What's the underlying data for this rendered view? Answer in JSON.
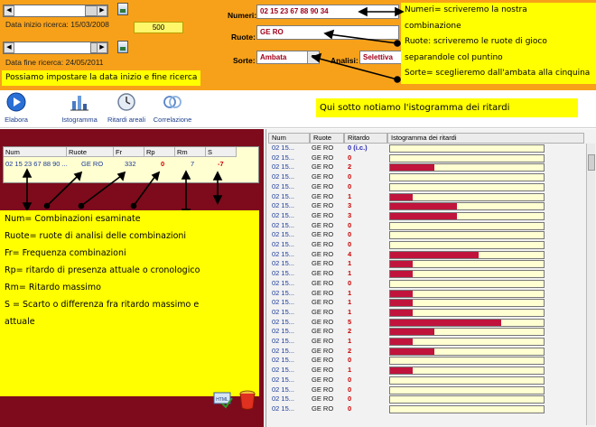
{
  "header": {
    "data_inizio_label": "Data inizio ricerca: 15/03/2008",
    "data_fine_label": "Data fine ricerca: 24/05/2011",
    "counter_value": "500",
    "numeri_label": "Numeri:",
    "numeri_value": "02 15 23 67 88 90 34",
    "ruote_label": "Ruote:",
    "ruote_value": "GE RO",
    "sorte_label": "Sorte:",
    "sorte_value": "Ambata",
    "analisi_label": "Analisi:",
    "analisi_value": "Selettiva"
  },
  "callouts": {
    "date_note": "Possiamo impostare la data inizio e fine ricerca",
    "right_note": [
      "Numeri= scriveremo la nostra",
      "combinazione",
      "Ruote: scriveremo le ruote di gioco",
      "separandole col puntino",
      "Sorte= sceglieremo dall'ambata alla cinquina"
    ],
    "hist_note": "Qui sotto notiamo l'istogramma dei ritardi"
  },
  "toolbar": {
    "elabora": "Elabora",
    "istogramma": "Istogramma",
    "ritardi_areali": "Ritardi areali",
    "correlazione": "Correlazione"
  },
  "left_table": {
    "headers": [
      "Num",
      "Ruote",
      "Fr",
      "Rp",
      "Rm",
      "S"
    ],
    "row": [
      "02 15 23 67 88 90 ...",
      "GE RO",
      "332",
      "0",
      "7",
      "-7"
    ]
  },
  "legend_lines": [
    "Num= Combinazioni esaminate",
    "Ruote= ruote di analisi delle combinazioni",
    "Fr= Frequenza combinazioni",
    "Rp= ritardo di presenza attuale o cronologico",
    "Rm= Ritardo massimo",
    "S = Scarto o differenza fra ritardo massimo e",
    "attuale"
  ],
  "right_table": {
    "headers": [
      "Num",
      "Ruote",
      "Ritardo",
      "Istogramma dei ritardi"
    ],
    "rows": [
      {
        "num": "02 15...",
        "ruote": "GE RO",
        "ritardo": "0 (i.c.)",
        "bar": 0
      },
      {
        "num": "02 15...",
        "ruote": "GE RO",
        "ritardo": "0",
        "bar": 0
      },
      {
        "num": "02 15...",
        "ruote": "GE RO",
        "ritardo": "2",
        "bar": 2
      },
      {
        "num": "02 15...",
        "ruote": "GE RO",
        "ritardo": "0",
        "bar": 0
      },
      {
        "num": "02 15...",
        "ruote": "GE RO",
        "ritardo": "0",
        "bar": 0
      },
      {
        "num": "02 15...",
        "ruote": "GE RO",
        "ritardo": "1",
        "bar": 1
      },
      {
        "num": "02 15...",
        "ruote": "GE RO",
        "ritardo": "3",
        "bar": 3
      },
      {
        "num": "02 15...",
        "ruote": "GE RO",
        "ritardo": "3",
        "bar": 3
      },
      {
        "num": "02 15...",
        "ruote": "GE RO",
        "ritardo": "0",
        "bar": 0
      },
      {
        "num": "02 15...",
        "ruote": "GE RO",
        "ritardo": "0",
        "bar": 0
      },
      {
        "num": "02 15...",
        "ruote": "GE RO",
        "ritardo": "0",
        "bar": 0
      },
      {
        "num": "02 15...",
        "ruote": "GE RO",
        "ritardo": "4",
        "bar": 4
      },
      {
        "num": "02 15...",
        "ruote": "GE RO",
        "ritardo": "1",
        "bar": 1
      },
      {
        "num": "02 15...",
        "ruote": "GE RO",
        "ritardo": "1",
        "bar": 1
      },
      {
        "num": "02 15...",
        "ruote": "GE RO",
        "ritardo": "0",
        "bar": 0
      },
      {
        "num": "02 15...",
        "ruote": "GE RO",
        "ritardo": "1",
        "bar": 1
      },
      {
        "num": "02 15...",
        "ruote": "GE RO",
        "ritardo": "1",
        "bar": 1
      },
      {
        "num": "02 15...",
        "ruote": "GE RO",
        "ritardo": "1",
        "bar": 1
      },
      {
        "num": "02 15...",
        "ruote": "GE RO",
        "ritardo": "5",
        "bar": 5
      },
      {
        "num": "02 15...",
        "ruote": "GE RO",
        "ritardo": "2",
        "bar": 2
      },
      {
        "num": "02 15...",
        "ruote": "GE RO",
        "ritardo": "1",
        "bar": 1
      },
      {
        "num": "02 15...",
        "ruote": "GE RO",
        "ritardo": "2",
        "bar": 2
      },
      {
        "num": "02 15...",
        "ruote": "GE RO",
        "ritardo": "0",
        "bar": 0
      },
      {
        "num": "02 15...",
        "ruote": "GE RO",
        "ritardo": "1",
        "bar": 1
      },
      {
        "num": "02 15...",
        "ruote": "GE RO",
        "ritardo": "0",
        "bar": 0
      },
      {
        "num": "02 15...",
        "ruote": "GE RO",
        "ritardo": "0",
        "bar": 0
      },
      {
        "num": "02 15...",
        "ruote": "GE RO",
        "ritardo": "0",
        "bar": 0
      },
      {
        "num": "02 15...",
        "ruote": "GE RO",
        "ritardo": "0",
        "bar": 0
      }
    ]
  },
  "bottom_icons": {
    "html_icon_text": "HTML"
  },
  "colors": {
    "panel_orange": "#f7a11a",
    "left_bg": "#7d0b1b",
    "bar_red": "#c0143c",
    "callout_yellow": "#ffff00"
  }
}
